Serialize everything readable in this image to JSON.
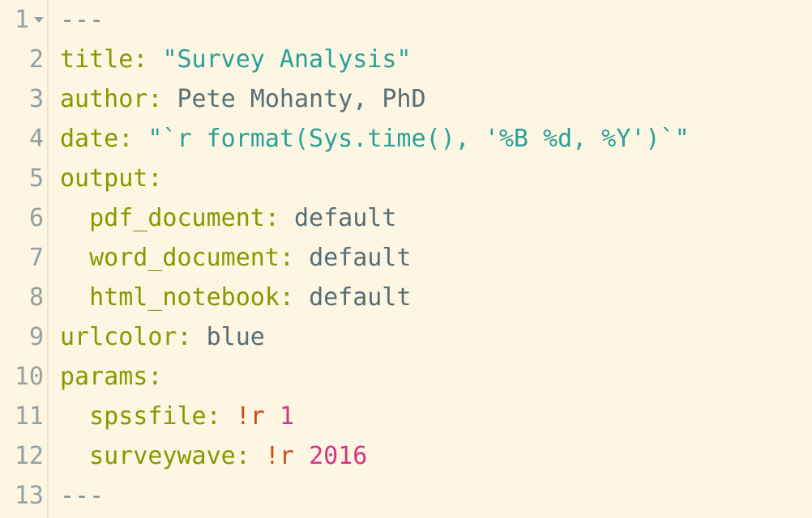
{
  "lines": [
    {
      "num": "1",
      "fold": true,
      "tokens": [
        {
          "cls": "t-light",
          "text": "---"
        }
      ]
    },
    {
      "num": "2",
      "tokens": [
        {
          "cls": "t-olive",
          "text": "title:"
        },
        {
          "cls": "",
          "text": " "
        },
        {
          "cls": "t-cyan",
          "text": "\"Survey Analysis\""
        }
      ]
    },
    {
      "num": "3",
      "tokens": [
        {
          "cls": "t-olive",
          "text": "author:"
        },
        {
          "cls": "",
          "text": " "
        },
        {
          "cls": "t-gray",
          "text": "Pete Mohanty, PhD"
        }
      ]
    },
    {
      "num": "4",
      "tokens": [
        {
          "cls": "t-olive",
          "text": "date:"
        },
        {
          "cls": "",
          "text": " "
        },
        {
          "cls": "t-cyan",
          "text": "\"`r format(Sys.time(), '%B %d, %Y')`\""
        }
      ]
    },
    {
      "num": "5",
      "tokens": [
        {
          "cls": "t-olive",
          "text": "output:"
        }
      ]
    },
    {
      "num": "6",
      "tokens": [
        {
          "cls": "",
          "text": "  "
        },
        {
          "cls": "t-olive",
          "text": "pdf_document:"
        },
        {
          "cls": "",
          "text": " "
        },
        {
          "cls": "t-gray",
          "text": "default"
        }
      ]
    },
    {
      "num": "7",
      "tokens": [
        {
          "cls": "",
          "text": "  "
        },
        {
          "cls": "t-olive",
          "text": "word_document:"
        },
        {
          "cls": "",
          "text": " "
        },
        {
          "cls": "t-gray",
          "text": "default"
        }
      ]
    },
    {
      "num": "8",
      "tokens": [
        {
          "cls": "",
          "text": "  "
        },
        {
          "cls": "t-olive",
          "text": "html_notebook:"
        },
        {
          "cls": "",
          "text": " "
        },
        {
          "cls": "t-gray",
          "text": "default"
        }
      ]
    },
    {
      "num": "9",
      "tokens": [
        {
          "cls": "t-olive",
          "text": "urlcolor:"
        },
        {
          "cls": "",
          "text": " "
        },
        {
          "cls": "t-gray",
          "text": "blue"
        }
      ]
    },
    {
      "num": "10",
      "tokens": [
        {
          "cls": "t-olive",
          "text": "params:"
        }
      ]
    },
    {
      "num": "11",
      "tokens": [
        {
          "cls": "",
          "text": "  "
        },
        {
          "cls": "t-olive",
          "text": "spssfile:"
        },
        {
          "cls": "",
          "text": " "
        },
        {
          "cls": "t-red",
          "text": "!r"
        },
        {
          "cls": "",
          "text": " "
        },
        {
          "cls": "t-mag",
          "text": "1"
        }
      ]
    },
    {
      "num": "12",
      "tokens": [
        {
          "cls": "",
          "text": "  "
        },
        {
          "cls": "t-olive",
          "text": "surveywave:"
        },
        {
          "cls": "",
          "text": " "
        },
        {
          "cls": "t-red",
          "text": "!r"
        },
        {
          "cls": "",
          "text": " "
        },
        {
          "cls": "t-mag",
          "text": "2016"
        }
      ]
    },
    {
      "num": "13",
      "tokens": [
        {
          "cls": "t-light",
          "text": "---"
        }
      ]
    }
  ]
}
